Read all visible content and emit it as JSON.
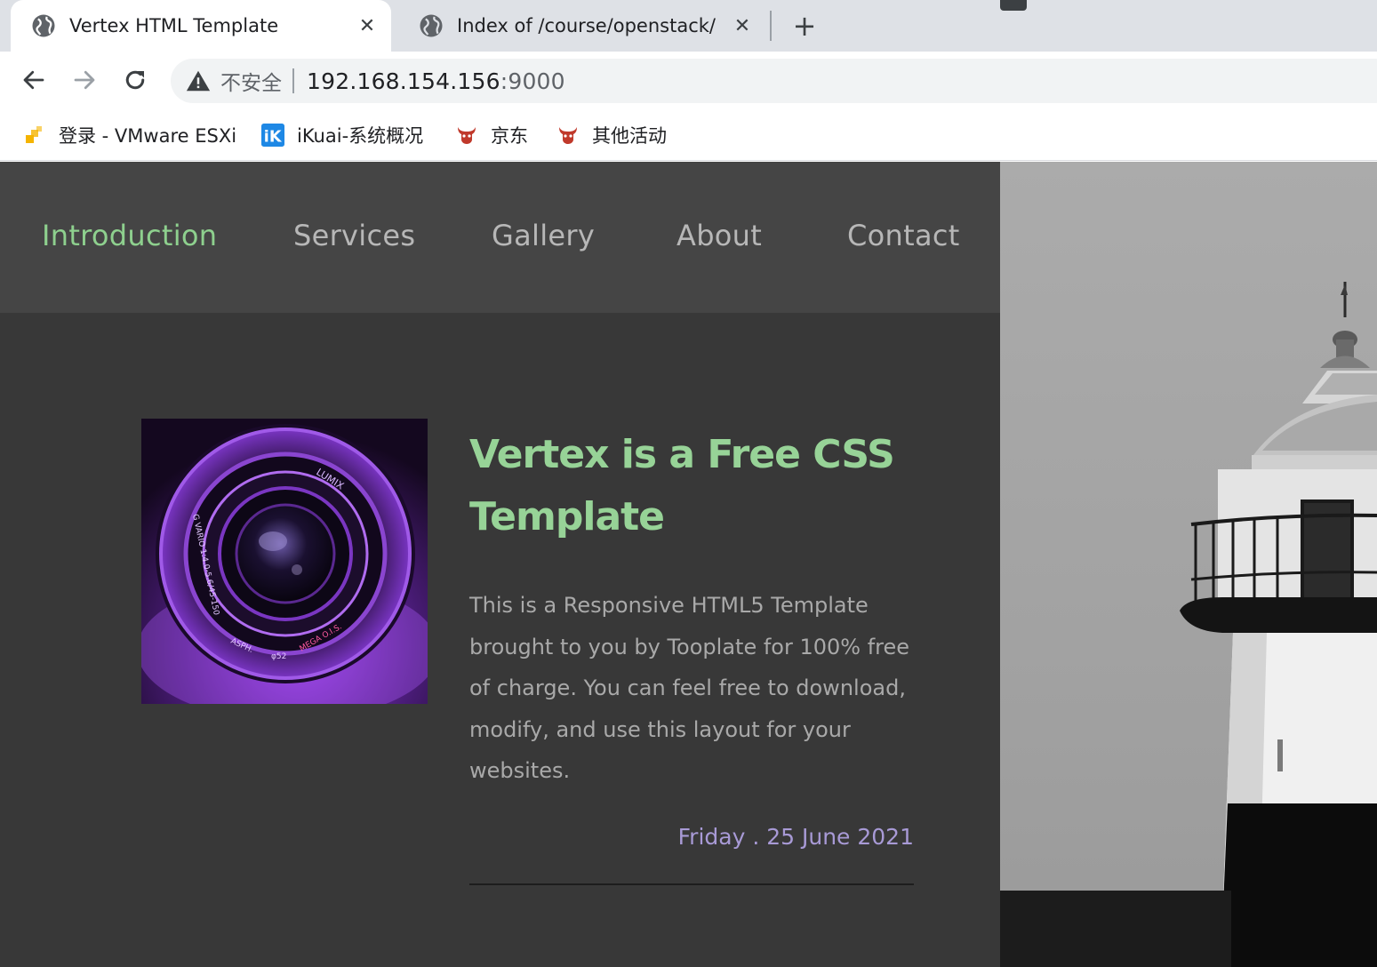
{
  "browser": {
    "tabs": [
      {
        "title": "Vertex HTML Template",
        "icon": "globe-icon",
        "active": true
      },
      {
        "title": "Index of /course/openstack/",
        "icon": "globe-icon",
        "active": false
      }
    ],
    "close_symbol": "✕",
    "new_tab_symbol": "+",
    "address": {
      "security_label": "不安全",
      "host": "192.168.154.156",
      "port": ":9000"
    },
    "bookmarks": [
      {
        "label": "登录 - VMware ESXi",
        "icon": "vmware-icon"
      },
      {
        "label": "iKuai-系统概况",
        "icon": "ikuai-icon"
      },
      {
        "label": "京东",
        "icon": "jd-icon"
      },
      {
        "label": "其他活动",
        "icon": "jd-icon"
      }
    ]
  },
  "site": {
    "nav": [
      {
        "label": "Introduction",
        "active": true
      },
      {
        "label": "Services",
        "active": false
      },
      {
        "label": "Gallery",
        "active": false
      },
      {
        "label": "About",
        "active": false
      },
      {
        "label": "Contact",
        "active": false
      }
    ],
    "headline": "Vertex is a Free CSS Template",
    "body": "This is a Responsive HTML5 Template brought to you by Tooplate for 100% free of charge. You can feel free to download, modify, and use this layout for your websites.",
    "date": "Friday . 25 June 2021",
    "thumbnail_alt": "camera-lens",
    "lens_text": {
      "top": "LUMIX",
      "left": "G VARIO 1:4.0-5.6/45-150",
      "bottom_left": "ASPH.",
      "bottom": "φ52",
      "bottom_right": "MEGA O.I.S."
    }
  },
  "colors": {
    "accent_green": "#8ed08e",
    "nav_gray": "#b7b7b7",
    "date_purple": "#a89ad6",
    "panel_bg": "#383838",
    "nav_bg": "#454545"
  }
}
